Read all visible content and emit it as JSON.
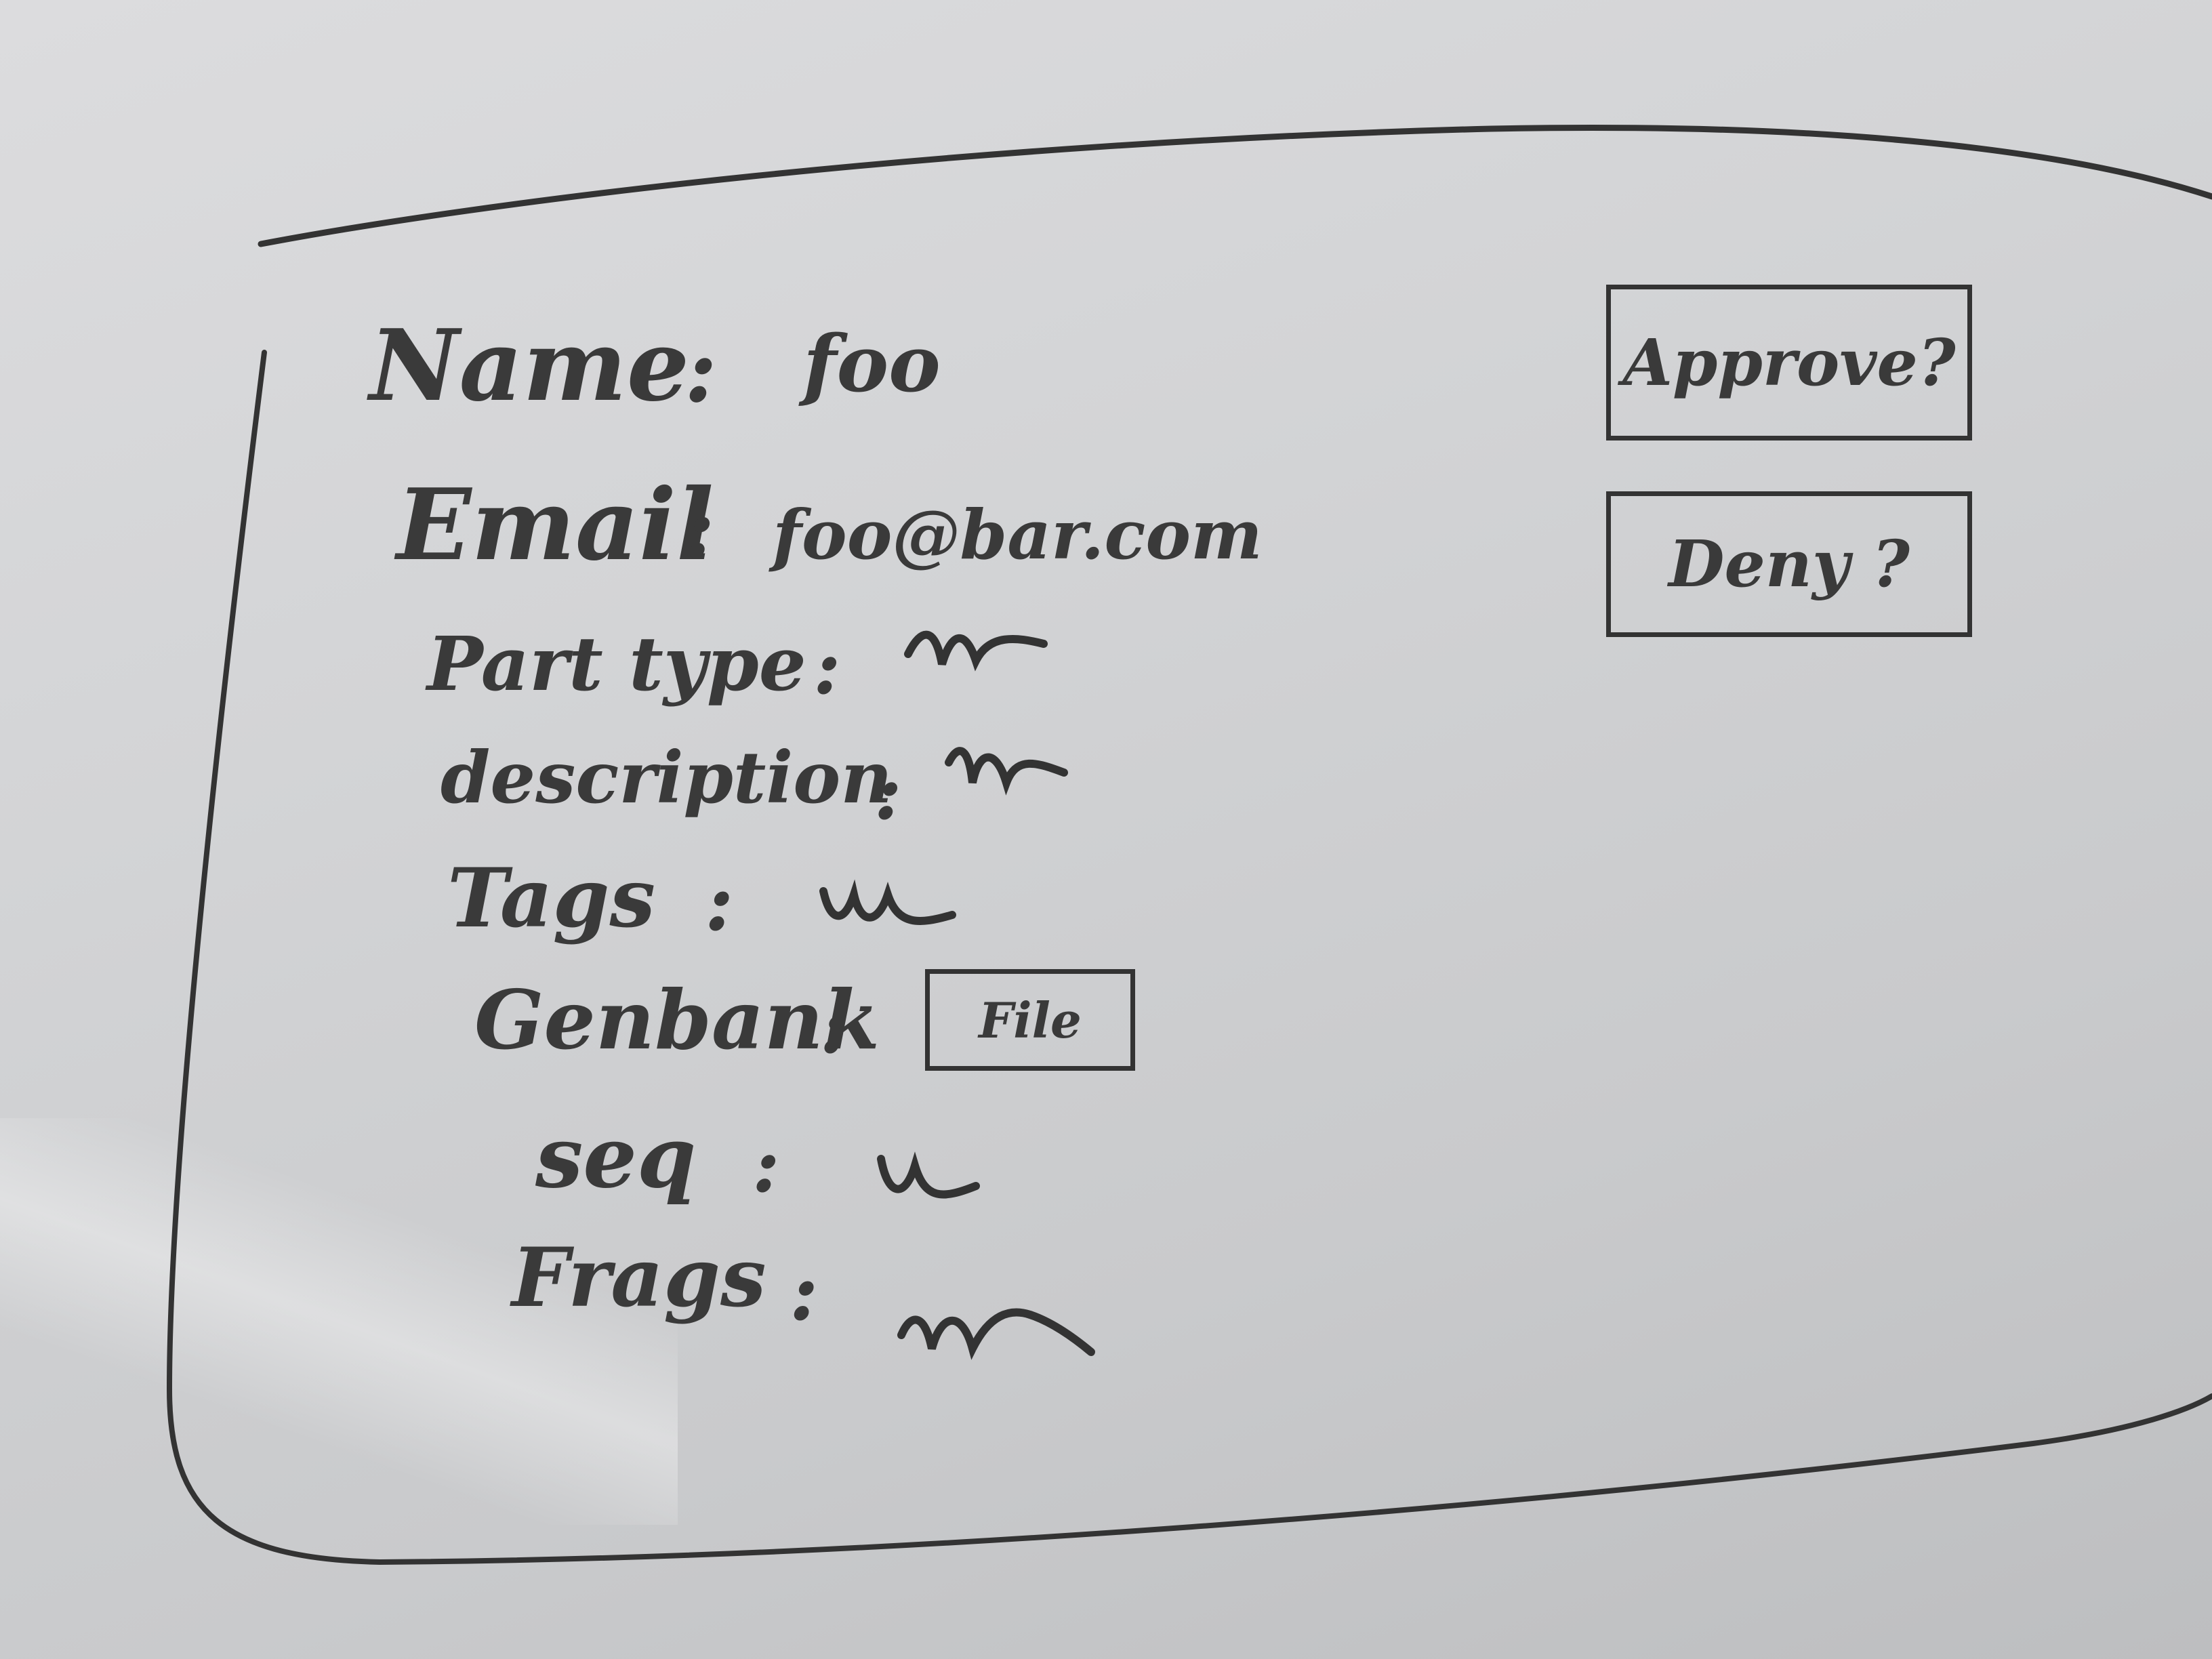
{
  "form": {
    "fields": [
      {
        "label": "Name",
        "value": "foo"
      },
      {
        "label": "Email",
        "value": "foo@bar.com"
      },
      {
        "label": "Part type",
        "value": ""
      },
      {
        "label": "description",
        "value": ""
      },
      {
        "label": "Tags",
        "value": ""
      },
      {
        "label": "Genbank",
        "value": ""
      },
      {
        "label": "seq",
        "value": ""
      },
      {
        "label": "Frags",
        "value": ""
      }
    ],
    "separator": ":",
    "file_button_label": "File"
  },
  "actions": {
    "approve_label": "Approve?",
    "deny_label": "Deny ?"
  },
  "colors": {
    "ink": "#333333",
    "board": "#d6d7d9"
  }
}
